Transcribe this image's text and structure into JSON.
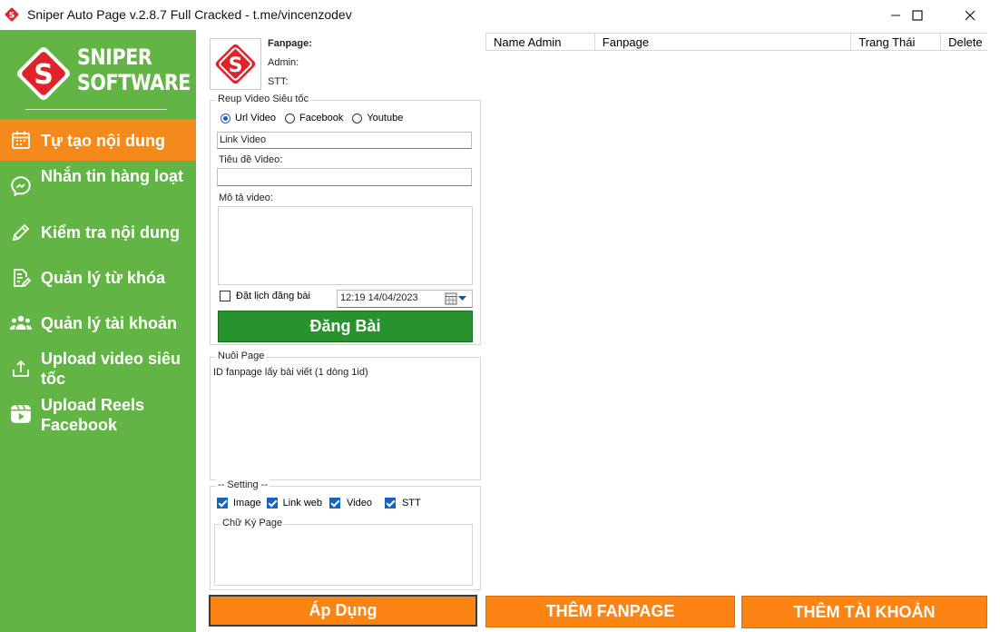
{
  "window": {
    "title": "Sniper Auto Page v.2.8.7 Full Cracked - t.me/vincenzodev"
  },
  "sidebar": {
    "logo": {
      "mark_letter": "S",
      "line1": "SNIPER",
      "line2": "SOFTWARE"
    },
    "items": [
      {
        "label": "Tự tạo nội dung",
        "icon": "calendar-icon",
        "active": true
      },
      {
        "label": "Nhắn tin hàng loạt",
        "icon": "messenger-icon",
        "active": false
      },
      {
        "label": "Kiểm tra nội dung",
        "icon": "pencil-icon",
        "active": false
      },
      {
        "label": "Quản lý từ khóa",
        "icon": "document-edit-icon",
        "active": false
      },
      {
        "label": "Quản lý tài khoản",
        "icon": "users-icon",
        "active": false
      },
      {
        "label": "Upload video siêu tốc",
        "icon": "upload-icon",
        "active": false
      },
      {
        "label": "Upload Reels Facebook",
        "icon": "reels-icon",
        "active": false
      }
    ]
  },
  "fanpage_info": {
    "logo_letter": "S",
    "fanpage_label": "Fanpage:",
    "admin_label": "Admin:",
    "stt_label": "STT:"
  },
  "reup": {
    "group_title": "Reup Video Siêu tốc",
    "source_options": [
      {
        "label": "Url Video",
        "selected": true
      },
      {
        "label": "Facebook",
        "selected": false
      },
      {
        "label": "Youtube",
        "selected": false
      }
    ],
    "link_video_value": "Link Video",
    "title_label": "Tiêu đề Video:",
    "title_value": "",
    "desc_label": "Mô tả video:",
    "desc_value": "",
    "schedule_label": "Đặt lịch đăng bài",
    "schedule_checked": false,
    "datetime_value": "12:19 14/04/2023",
    "post_button": "Đăng Bài"
  },
  "nuoi_page": {
    "group_title": "Nuôi Page",
    "placeholder": "ID fanpage lấy bài viết (1 dòng 1id)"
  },
  "setting": {
    "group_title": "-- Setting --",
    "options": [
      {
        "label": "Image",
        "checked": true
      },
      {
        "label": "Link web",
        "checked": true
      },
      {
        "label": "Video",
        "checked": true
      },
      {
        "label": "STT",
        "checked": true
      }
    ],
    "signature_label": "Chữ Ký Page"
  },
  "table": {
    "columns": [
      "Name Admin",
      "Fanpage",
      "Trang Thái",
      "Delete"
    ]
  },
  "buttons": {
    "apply": "Áp Dụng",
    "add_fanpage": "THÊM FANPAGE",
    "add_account": "THÊM TÀI KHOẢN"
  },
  "colors": {
    "sidebar_green": "#62b544",
    "active_orange": "#f48a1b",
    "post_green": "#28922c",
    "button_orange": "#fb8415",
    "logo_red": "#e0222b"
  }
}
